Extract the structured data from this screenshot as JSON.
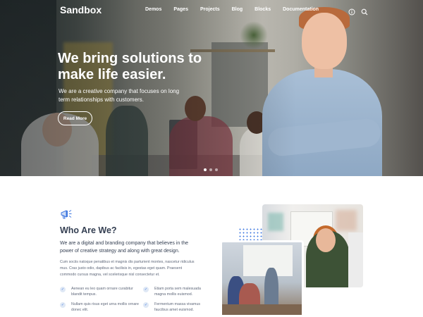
{
  "nav": {
    "brand": "Sandbox",
    "links": [
      "Demos",
      "Pages",
      "Projects",
      "Blog",
      "Blocks",
      "Documentation"
    ],
    "icons": [
      "info-icon",
      "search-icon"
    ]
  },
  "hero": {
    "title": "We bring solutions to make life easier.",
    "subtitle": "We are a creative company that focuses on long term relationships with customers.",
    "button": "Read More",
    "slides": 3,
    "active_slide": 1
  },
  "about": {
    "icon": "megaphone-icon",
    "title": "Who Are We?",
    "lead": "We are a digital and branding company that believes in the power of creative strategy and along with great design.",
    "body": "Cum sociis natoque penatibus et magnis dis parturient montes, nascetur ridiculus mus. Cras justo odio, dapibus ac facilisis in, egestas eget quam. Praesent commodo cursus magna, vel scelerisque nisl consectetur et.",
    "checks": [
      "Aenean eu leo quam ornare curabitur blandit tempus.",
      "Etiam porta sem malesuada magna mollis euismod.",
      "Nullam quis risus eget urna mollis ornare donec elit.",
      "Fermentum massa vivamus faucibus amet euismod."
    ]
  },
  "colors": {
    "primary": "#3f78e0",
    "heading": "#343f52",
    "body": "#60697b"
  }
}
